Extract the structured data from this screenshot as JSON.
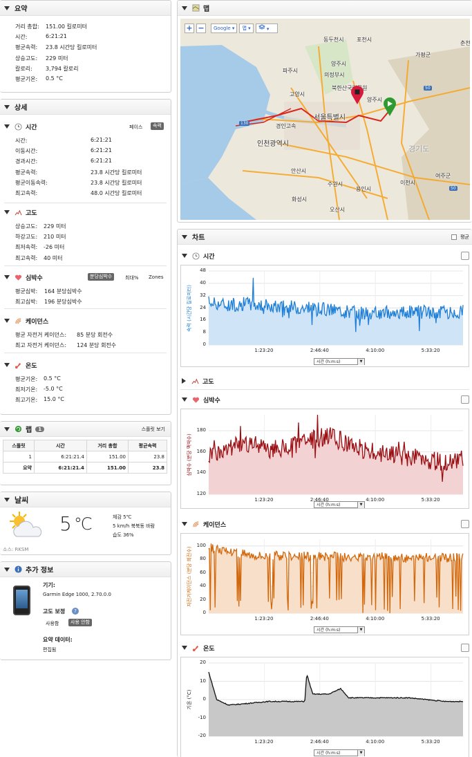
{
  "summary": {
    "title": "요약",
    "rows": [
      {
        "k": "거리 총합:",
        "v": "151.00 킬로미터"
      },
      {
        "k": "시간:",
        "v": "6:21:21"
      },
      {
        "k": "평균속력:",
        "v": "23.8 시간당 킬로미터"
      },
      {
        "k": "상승고도:",
        "v": "229 미터"
      },
      {
        "k": "칼로리:",
        "v": "3,794 칼로리"
      },
      {
        "k": "평균기온:",
        "v": "0.5 °C"
      }
    ]
  },
  "detail": {
    "title": "상세",
    "time": {
      "title": "시간",
      "pace": "페이스",
      "speed": "속력",
      "rows": [
        {
          "k": "시간:",
          "v": "6:21:21"
        },
        {
          "k": "이동시간:",
          "v": "6:21:21"
        },
        {
          "k": "경과시간:",
          "v": "6:21:21"
        },
        {
          "k": "평균속력:",
          "v": "23.8 시간당 킬로미터"
        },
        {
          "k": "평균이동속력:",
          "v": "23.8 시간당 킬로미터"
        },
        {
          "k": "최고속력:",
          "v": "48.0 시간당 킬로미터"
        }
      ]
    },
    "elev": {
      "title": "고도",
      "rows": [
        {
          "k": "상승고도:",
          "v": "229 미터"
        },
        {
          "k": "하강고도:",
          "v": "210 미터"
        },
        {
          "k": "최저속력:",
          "v": "-26 미터"
        },
        {
          "k": "최고속력:",
          "v": "40 미터"
        }
      ]
    },
    "hr": {
      "title": "심박수",
      "b1": "분당심박수",
      "b2": "최대%",
      "b3": "Zones",
      "rows": [
        {
          "k": "평균심박:",
          "v": "164 분당심박수"
        },
        {
          "k": "최고심박:",
          "v": "196 분당심박수"
        }
      ]
    },
    "cad": {
      "title": "케이던스",
      "rows": [
        {
          "k": "평균 자전거 케이던스:",
          "v": "85 분당 회전수"
        },
        {
          "k": "최고 자전거 케이던스:",
          "v": "124 분당 회전수"
        }
      ]
    },
    "temp": {
      "title": "온도",
      "rows": [
        {
          "k": "평균기온:",
          "v": "0.5 °C"
        },
        {
          "k": "최저기온:",
          "v": "-5.0 °C"
        },
        {
          "k": "최고기온:",
          "v": "15.0 °C"
        }
      ]
    }
  },
  "laps": {
    "title": "랩",
    "count": "1",
    "view": "스플릿 보기",
    "headers": [
      "스플릿",
      "시간",
      "거리 총합",
      "평균속력"
    ],
    "rows": [
      [
        "1",
        "6:21:21.4",
        "151.00",
        "23.8"
      ],
      [
        "요약",
        "6:21:21.4",
        "151.00",
        "23.8"
      ]
    ]
  },
  "weather": {
    "title": "날씨",
    "temp": "5",
    "unit": "℃",
    "feels": "체감 5℃",
    "wind": "5 km/h 북북동 바람",
    "humidity": "습도 36%",
    "source": "소스: RKSM"
  },
  "info": {
    "title": "추가 정보",
    "device_label": "기기:",
    "device": "Garmin Edge 1000, 2.70.0.0",
    "elev_corr": "고도 보정",
    "use": "사용함",
    "nouse": "사용 안함",
    "summary_label": "요약 데이터:",
    "summary_val": "편집됨"
  },
  "map": {
    "title": "맵",
    "provider": "Google",
    "maptype": "맵",
    "plus": "+",
    "minus": "−",
    "places": [
      "동두천시",
      "포천시",
      "가평군",
      "춘천",
      "양주시",
      "파주시",
      "의정부시",
      "북한산국립공원",
      "고양시",
      "양주시",
      "서울특별시",
      "인천광역시",
      "경인고속",
      "경기도",
      "안산시",
      "수원시",
      "용인시",
      "이천시",
      "여주군",
      "화성시",
      "오산시",
      "130",
      "50",
      "50"
    ]
  },
  "charts": {
    "title": "차트",
    "avg": "평균",
    "xsel": "시간 (h:m:s)",
    "speed": {
      "title": "시간",
      "ylabel": "속력 (시간당 킬로미터)",
      "color": "#1f7fd6",
      "fill": "#cfe4f7",
      "ylim": [
        0,
        48
      ],
      "ticks": [
        48,
        40,
        32,
        24,
        16,
        8,
        0
      ]
    },
    "elev": {
      "title": "고도"
    },
    "hr": {
      "title": "심박수",
      "ylabel": "심박수 (분당 맥박수)",
      "color": "#9a0f14",
      "fill": "#f2d2d2",
      "ylim": [
        120,
        195
      ],
      "ticks": [
        180,
        160,
        140,
        120
      ]
    },
    "cad": {
      "title": "케이던스",
      "ylabel": "자전거케이던스 (분당 회전수)",
      "color": "#d2680b",
      "fill": "#f7dfc9",
      "ylim": [
        0,
        110
      ],
      "ticks": [
        100,
        80,
        60,
        40,
        20,
        0
      ]
    },
    "temp": {
      "title": "온도",
      "ylabel": "기온 (°C)",
      "color": "#111111",
      "fill": "#c8c8c8",
      "ylim": [
        -20,
        20
      ],
      "ticks": [
        20,
        10,
        0,
        -10,
        -20
      ]
    },
    "xticks": [
      "1:23:20",
      "2:46:40",
      "4:10:00",
      "5:33:20"
    ]
  },
  "chart_data": [
    {
      "type": "area",
      "title": "",
      "ylabel": "속력 (시간당 킬로미터)",
      "xlabel": "시간 (h:m:s)",
      "x_ticks": [
        "1:23:20",
        "2:46:40",
        "4:10:00",
        "5:33:20"
      ],
      "ylim": [
        0,
        48
      ],
      "x_hours": [
        0,
        0.5,
        1,
        1.5,
        2,
        2.5,
        3,
        3.5,
        4,
        4.5,
        5,
        5.5,
        6,
        6.35
      ],
      "values": [
        28,
        26,
        27,
        25,
        25,
        24,
        23,
        22,
        20,
        21,
        22,
        21,
        21,
        22
      ]
    },
    {
      "type": "area",
      "title": "",
      "ylabel": "심박수 (분당 맥박수)",
      "xlabel": "시간 (h:m:s)",
      "x_ticks": [
        "1:23:20",
        "2:46:40",
        "4:10:00",
        "5:33:20"
      ],
      "ylim": [
        120,
        195
      ],
      "x_hours": [
        0,
        0.5,
        1,
        1.5,
        2,
        2.5,
        3,
        3.5,
        4,
        4.5,
        5,
        5.5,
        6,
        6.35
      ],
      "values": [
        158,
        165,
        168,
        162,
        165,
        172,
        175,
        168,
        160,
        158,
        155,
        152,
        150,
        155
      ]
    },
    {
      "type": "area",
      "title": "",
      "ylabel": "자전거케이던스 (분당 회전수)",
      "xlabel": "시간 (h:m:s)",
      "x_ticks": [
        "1:23:20",
        "2:46:40",
        "4:10:00",
        "5:33:20"
      ],
      "ylim": [
        0,
        110
      ],
      "x_hours": [
        0,
        0.5,
        1,
        1.5,
        2,
        2.5,
        3,
        3.5,
        4,
        4.5,
        5,
        5.5,
        6,
        6.35
      ],
      "values": [
        98,
        92,
        88,
        85,
        86,
        84,
        85,
        82,
        84,
        83,
        82,
        84,
        82,
        85
      ]
    },
    {
      "type": "area",
      "title": "",
      "ylabel": "기온 (°C)",
      "xlabel": "시간 (h:m:s)",
      "x_ticks": [
        "1:23:20",
        "2:46:40",
        "4:10:00",
        "5:33:20"
      ],
      "ylim": [
        -20,
        20
      ],
      "x_hours": [
        0,
        0.2,
        0.5,
        1,
        1.5,
        2,
        2.4,
        2.45,
        2.6,
        3,
        3.3,
        3.5,
        4,
        5,
        5.9,
        6.35
      ],
      "values": [
        15,
        0,
        -3,
        -2,
        -1,
        -1,
        -1,
        14,
        3,
        3,
        6,
        1,
        1,
        1,
        -1,
        -1
      ]
    }
  ]
}
